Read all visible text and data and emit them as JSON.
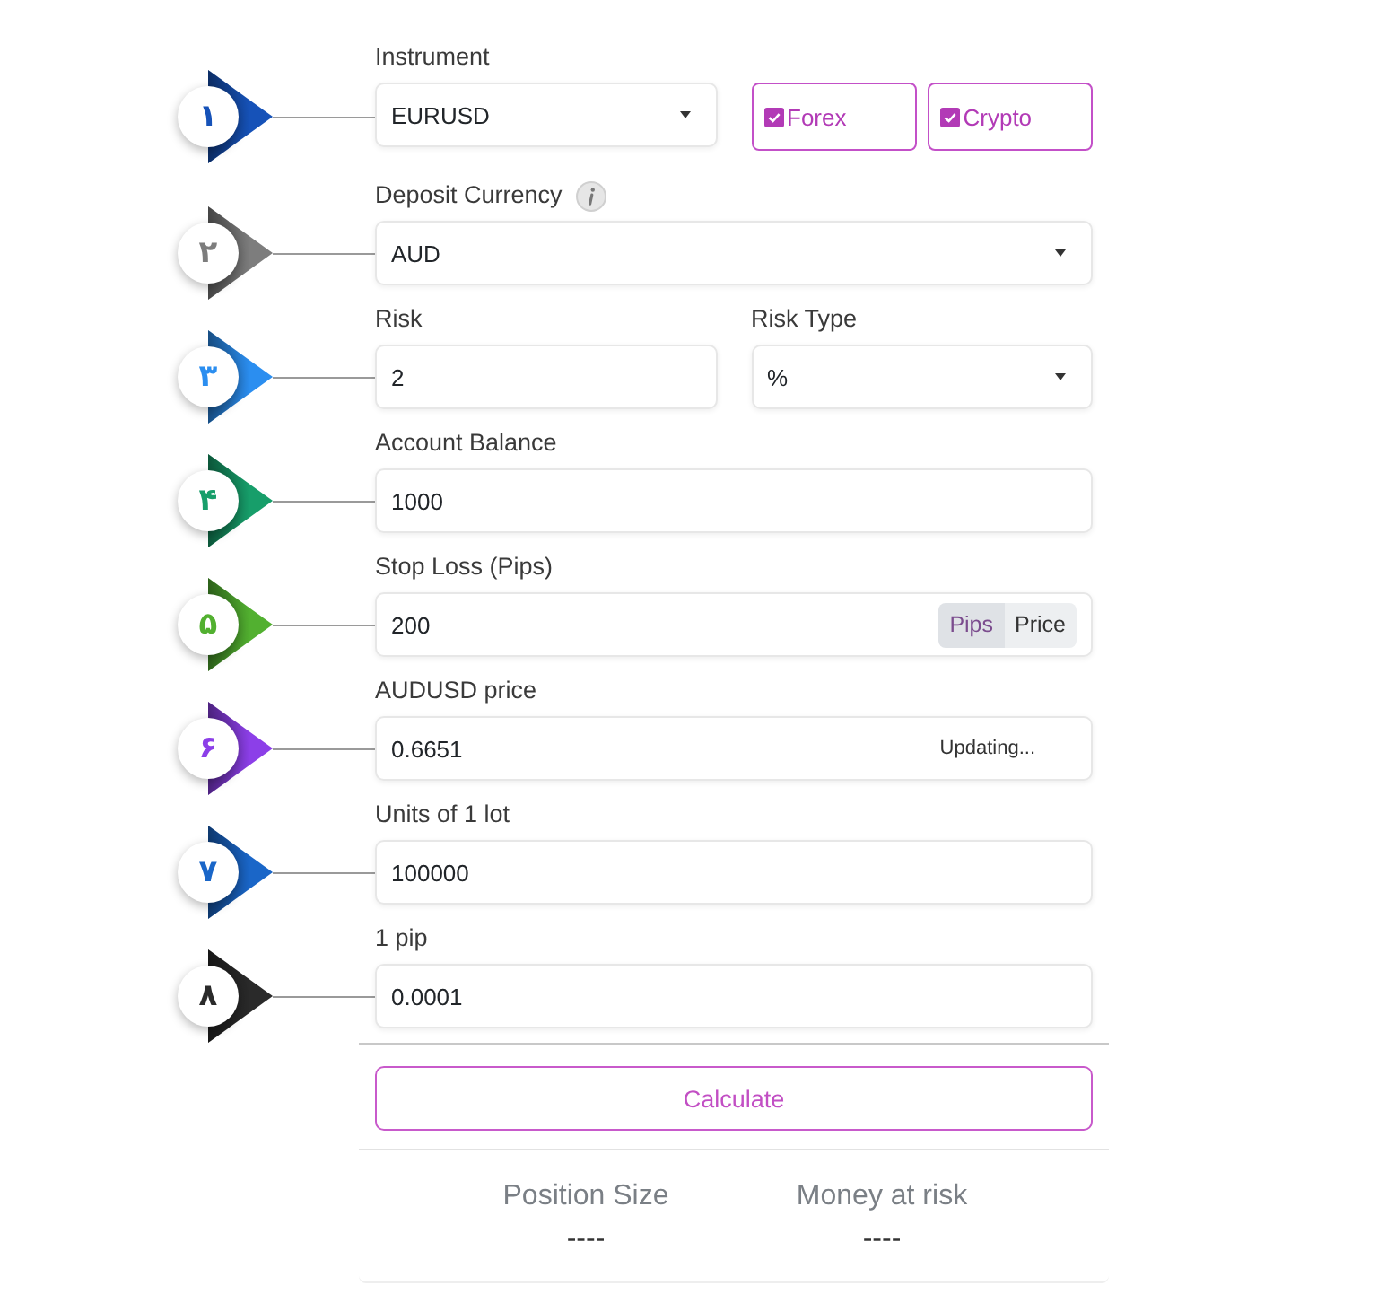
{
  "steps": [
    {
      "number": "۱",
      "color": "#1652b8",
      "fields": [
        {
          "kind": "select",
          "label": "Instrument",
          "value": "EURUSD"
        }
      ],
      "filters": [
        {
          "label": "Forex",
          "checked": true
        },
        {
          "label": "Crypto",
          "checked": true
        }
      ]
    },
    {
      "number": "۲",
      "color": "#7d7d7d",
      "fields": [
        {
          "kind": "select",
          "label": "Deposit Currency",
          "info": true,
          "value": "AUD"
        }
      ]
    },
    {
      "number": "۳",
      "color": "#2b8ef0",
      "fields": [
        {
          "kind": "input",
          "label": "Risk",
          "value": "2"
        },
        {
          "kind": "select",
          "label": "Risk Type",
          "value": "%"
        }
      ]
    },
    {
      "number": "۴",
      "color": "#179e6a",
      "fields": [
        {
          "kind": "input",
          "label": "Account Balance",
          "value": "1000"
        }
      ]
    },
    {
      "number": "۵",
      "color": "#52b030",
      "fields": [
        {
          "kind": "toggle",
          "label": "Stop Loss (Pips)",
          "value": "200",
          "options": [
            {
              "label": "Pips",
              "selected": true
            },
            {
              "label": "Price",
              "selected": false
            }
          ]
        }
      ]
    },
    {
      "number": "۶",
      "color": "#8c3fe8",
      "fields": [
        {
          "kind": "status",
          "label": "AUDUSD price",
          "value": "0.6651",
          "status": "Updating..."
        }
      ]
    },
    {
      "number": "۷",
      "color": "#1a66c8",
      "fields": [
        {
          "kind": "input",
          "label": "Units of 1 lot",
          "value": "100000"
        }
      ]
    },
    {
      "number": "۸",
      "color": "#2a2a2a",
      "fields": [
        {
          "kind": "input",
          "label": "1 pip",
          "value": "0.0001"
        }
      ]
    }
  ],
  "calculate_button": {
    "label": "Calculate"
  },
  "results": [
    {
      "label": "Position Size",
      "value": "----"
    },
    {
      "label": "Money at risk",
      "value": "----"
    }
  ]
}
